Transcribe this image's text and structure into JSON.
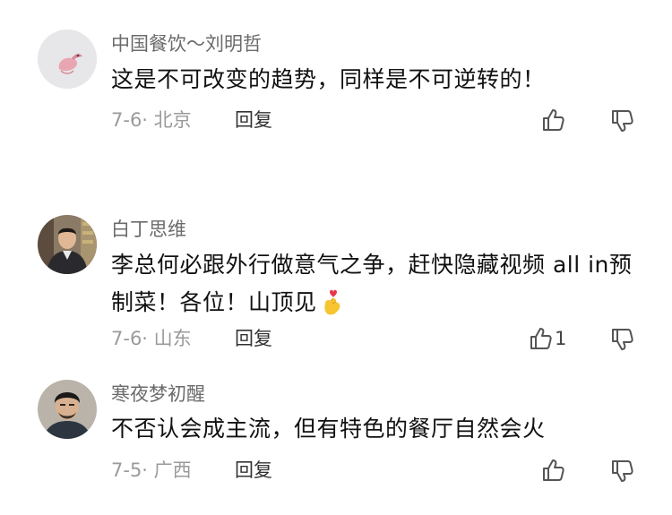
{
  "comments": [
    {
      "username": "中国餐饮～刘明哲",
      "text": "这是不可改变的趋势，同样是不可逆转的！",
      "date_location": "7-6· 北京",
      "reply_label": "回复",
      "like_count": "",
      "avatar_icon": "pink-bird-avatar"
    },
    {
      "username": "白丁思维",
      "text": "李总何必跟外行做意气之争，赶快隐藏视频 all in预制菜！各位！山顶见",
      "text_emoji": "finger-heart-emoji",
      "date_location": "7-6· 山东",
      "reply_label": "回复",
      "like_count": "1",
      "avatar_icon": "man-portrait-avatar"
    },
    {
      "username": "寒夜梦初醒",
      "text": "不否认会成主流，但有特色的餐厅自然会火",
      "date_location": "7-5· 广西",
      "reply_label": "回复",
      "like_count": "",
      "avatar_icon": "man-portrait-avatar"
    }
  ],
  "colors": {
    "username": "#6b6b6b",
    "text": "#111111",
    "meta": "#9a9a9a",
    "reply": "#333333",
    "icon": "#555555"
  }
}
